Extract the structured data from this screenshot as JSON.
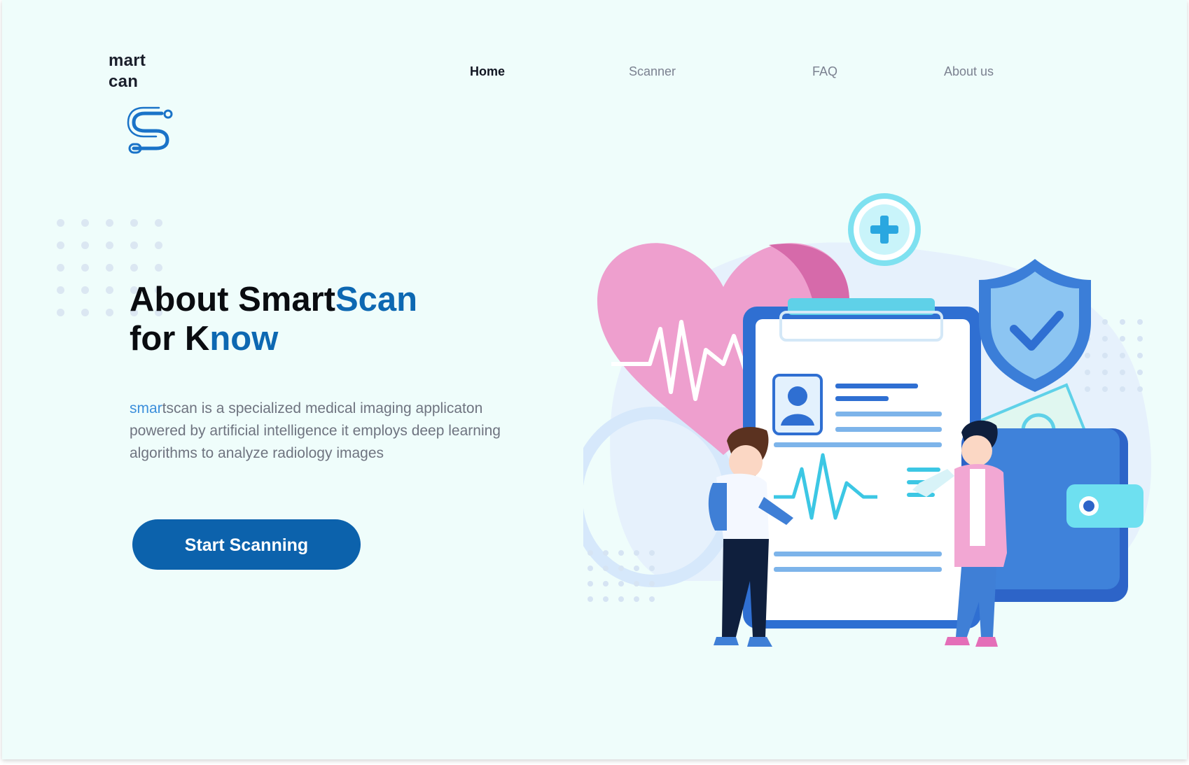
{
  "brand": {
    "line1": "mart",
    "line2": "can",
    "logo_icon": "stethoscope-s-logo-icon"
  },
  "nav": {
    "items": [
      "Home",
      "Scanner",
      "FAQ",
      "About us"
    ],
    "active": "Home"
  },
  "hero": {
    "title_part1": "About  Smart",
    "title_part2": "Scan",
    "title_part3": "for K",
    "title_part4": "now",
    "desc_highlight": "smar",
    "desc_rest": "tscan is a specialized medical imaging applicaton powered by artificial intelligence it employs deep learning algorithms to analyze radiology images",
    "cta_label": "Start Scanning"
  },
  "illustration": {
    "icons": [
      "heart-pulse-icon",
      "plus-circle-icon",
      "clipboard-report-icon",
      "shield-check-icon",
      "wallet-icon",
      "doctor-figure",
      "patient-figure"
    ]
  },
  "colors": {
    "background": "#effdfb",
    "accent": "#0d68b2",
    "button": "#0c62ac",
    "muted_text": "#6f7480"
  }
}
